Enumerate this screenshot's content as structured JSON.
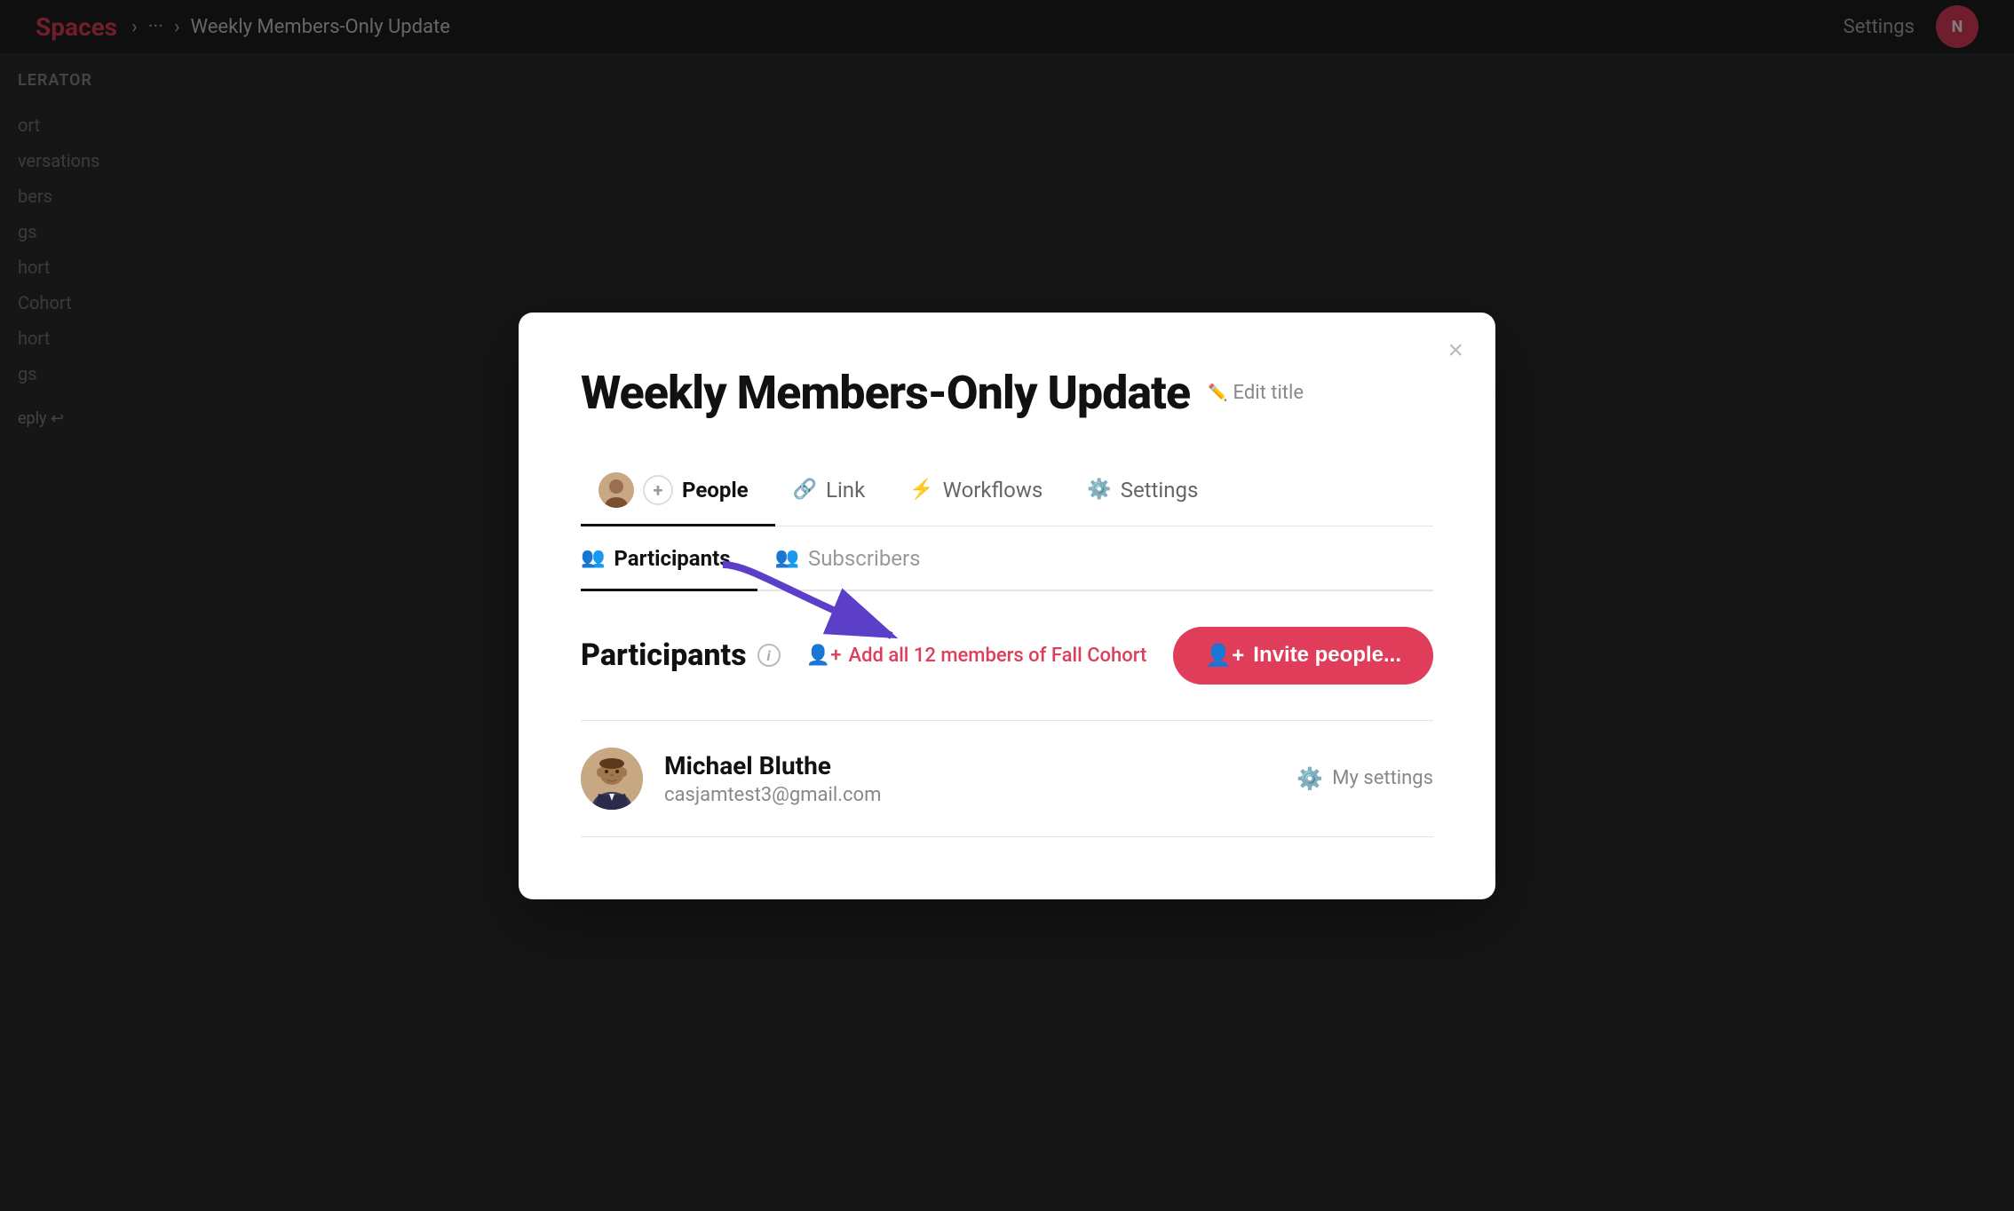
{
  "topbar": {
    "brand": "Spaces",
    "breadcrumb_separator": "›",
    "breadcrumb_more": "···",
    "breadcrumb_current": "Weekly Members-Only Update",
    "settings_label": "Settings",
    "avatar_initials": "N"
  },
  "sidebar": {
    "label": "LERATOR",
    "items": [
      {
        "label": "ort"
      },
      {
        "label": "versations"
      },
      {
        "label": "bers"
      },
      {
        "label": "gs"
      },
      {
        "label": "hort"
      },
      {
        "label": "Cohort"
      },
      {
        "label": "hort"
      },
      {
        "label": "gs"
      }
    ]
  },
  "modal": {
    "title": "Weekly Members-Only Update",
    "edit_title_label": "Edit title",
    "close_icon": "×",
    "tabs": [
      {
        "id": "people",
        "label": "People",
        "active": true,
        "has_avatar": true
      },
      {
        "id": "link",
        "label": "Link",
        "active": false,
        "icon": "🔗"
      },
      {
        "id": "workflows",
        "label": "Workflows",
        "active": false,
        "icon": "⚡"
      },
      {
        "id": "settings",
        "label": "Settings",
        "active": false,
        "icon": "⚙️"
      }
    ],
    "sub_tabs": [
      {
        "id": "participants",
        "label": "Participants",
        "active": true
      },
      {
        "id": "subscribers",
        "label": "Subscribers",
        "active": false
      }
    ],
    "participants_section": {
      "title": "Participants",
      "info_icon": "i",
      "add_cohort_label": "Add all 12 members of Fall Cohort",
      "invite_button_label": "Invite people...",
      "invite_icon": "👤+"
    },
    "participants": [
      {
        "id": 1,
        "name": "Michael Bluthe",
        "email": "casjamtest3@gmail.com",
        "settings_label": "My settings"
      }
    ]
  },
  "arrow": {
    "color": "#5b3fc8",
    "label": ""
  }
}
